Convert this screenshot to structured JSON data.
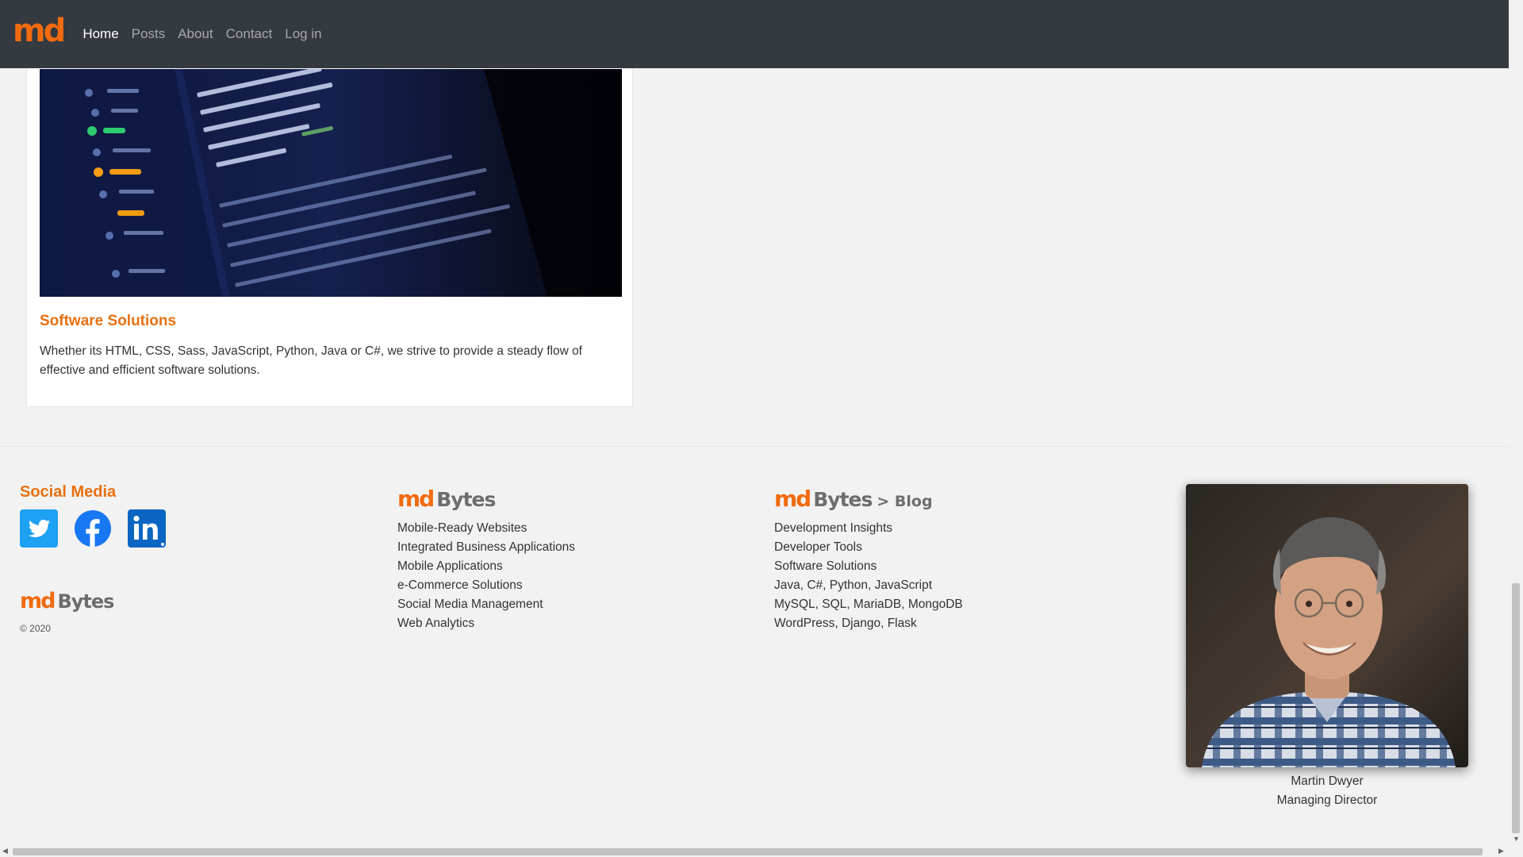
{
  "navbar": {
    "brand": "md",
    "links": [
      "Home",
      "Posts",
      "About",
      "Contact",
      "Log in"
    ],
    "active": "Home"
  },
  "card": {
    "image_icon": "code-screenshot-image",
    "title": "Software Solutions",
    "text": "Whether its HTML, CSS, Sass, JavaScript, Python, Java or C#, we strive to provide a steady flow of effective and efficient software solutions."
  },
  "footer": {
    "social": {
      "title": "Social Media",
      "icons": [
        "twitter-icon",
        "facebook-icon",
        "linkedin-icon"
      ],
      "logo_md": "md",
      "logo_bytes": "Bytes",
      "copyright": "© 2020"
    },
    "services": {
      "logo_md": "md",
      "logo_bytes": "Bytes",
      "items": [
        "Mobile-Ready Websites",
        "Integrated Business Applications",
        "Mobile Applications",
        "e-Commerce Solutions",
        "Social Media Management",
        "Web Analytics"
      ]
    },
    "blog": {
      "logo_md": "md",
      "logo_bytes": "Bytes",
      "logo_blog": "> Blog",
      "items": [
        "Development Insights",
        "Developer Tools",
        "Software Solutions",
        "Java, C#, Python, JavaScript",
        "MySQL, SQL, MariaDB, MongoDB",
        "WordPress, Django, Flask"
      ]
    },
    "person": {
      "name": "Martin Dwyer",
      "role": "Managing Director"
    }
  },
  "colors": {
    "accent": "#e8700f",
    "navbar": "#343a40",
    "background": "#f2f2f2"
  }
}
